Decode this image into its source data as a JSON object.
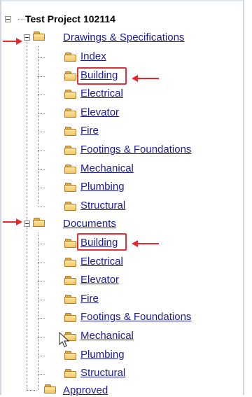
{
  "tree": {
    "root": {
      "label": "Test Project 102114"
    },
    "drawings": {
      "label": "Drawings & Specifications",
      "children": [
        "Index",
        "Building",
        "Electrical",
        "Elevator",
        "Fire",
        "Footings & Foundations",
        "Mechanical",
        "Plumbing",
        "Structural"
      ]
    },
    "documents": {
      "label": "Documents",
      "children": [
        "Building",
        "Electrical",
        "Elevator",
        "Fire",
        "Footings & Foundations",
        "Mechanical",
        "Plumbing",
        "Structural"
      ]
    },
    "approved": {
      "label": "Approved"
    }
  },
  "colors": {
    "link": "#1c1d9e",
    "highlight_box": "#e0303a",
    "annotation_arrow": "#e8262d",
    "folder": "#f4c65f"
  }
}
